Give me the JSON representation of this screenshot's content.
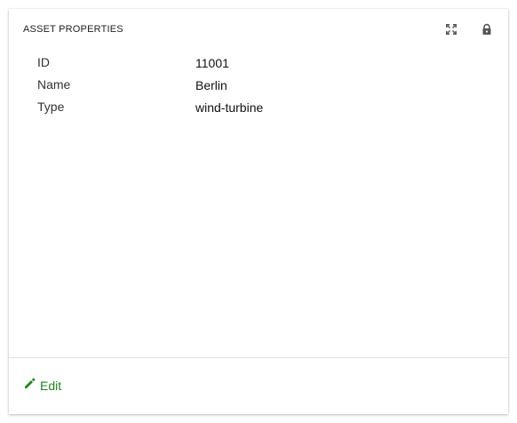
{
  "card": {
    "title": "ASSET PROPERTIES",
    "header_icons": [
      "expand-icon",
      "lock-icon"
    ]
  },
  "properties": [
    {
      "key": "ID",
      "value": "11001"
    },
    {
      "key": "Name",
      "value": "Berlin"
    },
    {
      "key": "Type",
      "value": "wind-turbine"
    }
  ],
  "footer": {
    "edit_label": "Edit",
    "edit_icon": "pencil-icon"
  },
  "colors": {
    "accent": "#1a8a1a",
    "text": "#111111",
    "icon": "#555555",
    "divider": "#e2e2e2"
  }
}
